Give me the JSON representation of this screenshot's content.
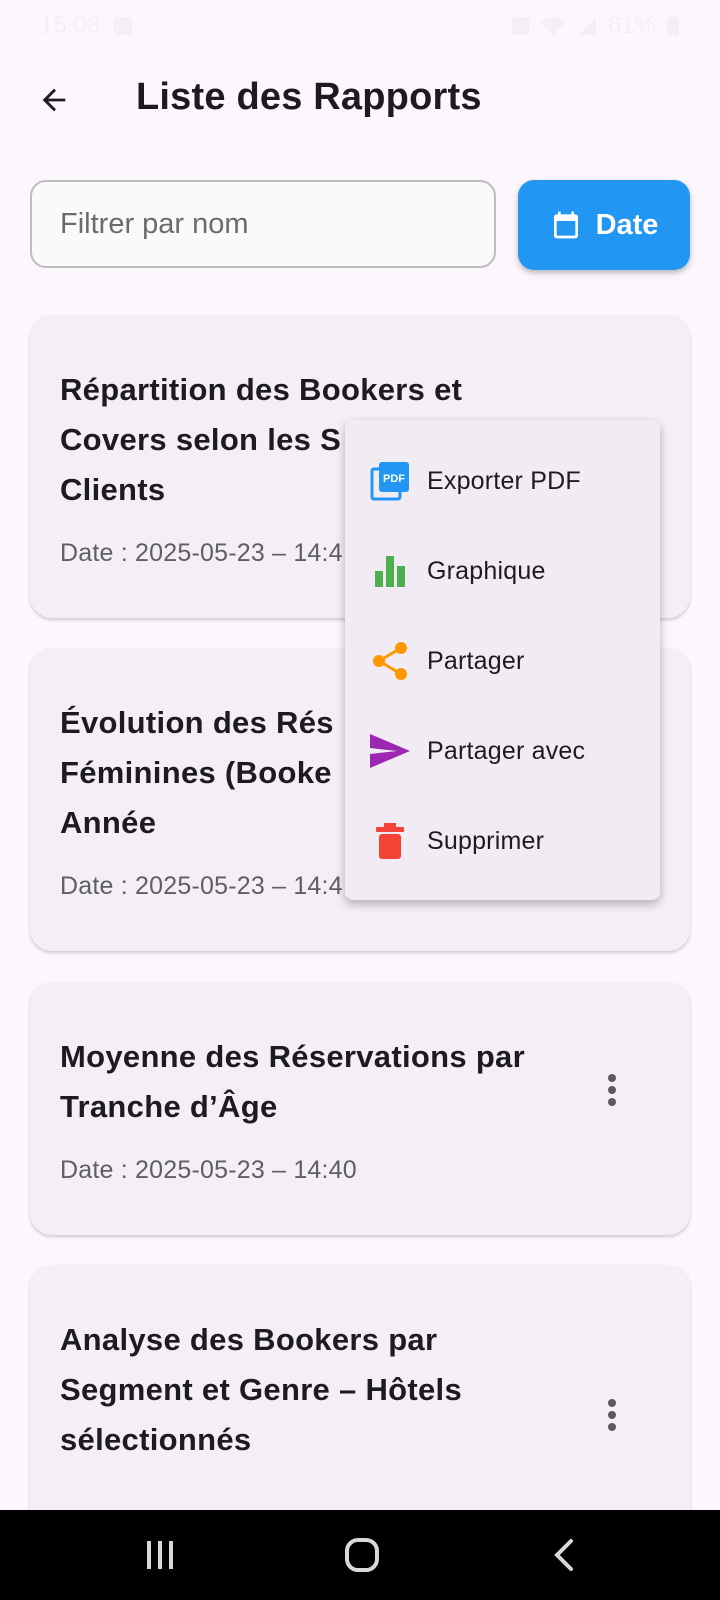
{
  "status_bar": {
    "time": "15:08",
    "battery": "61%"
  },
  "app_bar": {
    "title": "Liste des Rapports"
  },
  "filter": {
    "placeholder": "Filtrer par nom",
    "date_button_label": "Date"
  },
  "reports": [
    {
      "title": "Répartition des Bookers et Covers selon les S",
      "title_line2": "Clients",
      "date": "Date : 2025-05-23 – 14:4"
    },
    {
      "title": "Évolution des Rés",
      "title_line2": "Féminines (Booke",
      "title_line3": "Année",
      "date": "Date : 2025-05-23 – 14:4"
    },
    {
      "title": "Moyenne des Réservations par Tranche d’Âge",
      "date": "Date : 2025-05-23 – 14:40"
    },
    {
      "title": "Analyse des Bookers par Segment et Genre – Hôtels sélectionnés"
    }
  ],
  "context_menu": {
    "items": [
      {
        "label": "Exporter PDF",
        "icon": "pdf-icon",
        "color": "#2196f3"
      },
      {
        "label": "Graphique",
        "icon": "bar-chart-icon",
        "color": "#4caf50"
      },
      {
        "label": "Partager",
        "icon": "share-icon",
        "color": "#ff9800"
      },
      {
        "label": "Partager avec",
        "icon": "send-icon",
        "color": "#9c27b0"
      },
      {
        "label": "Supprimer",
        "icon": "delete-icon",
        "color": "#f44336"
      }
    ]
  },
  "colors": {
    "primary": "#2196f3",
    "background": "#fcf6fd",
    "card": "#f4eff6"
  }
}
